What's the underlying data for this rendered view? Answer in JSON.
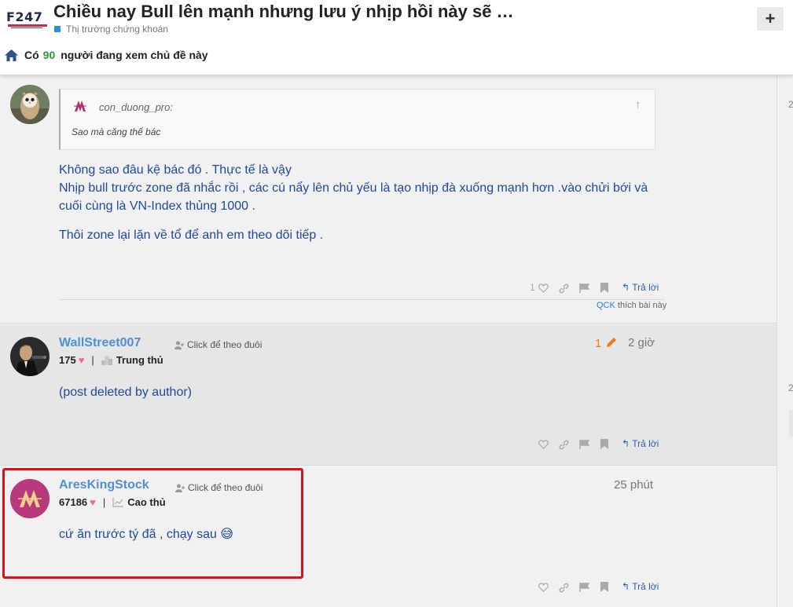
{
  "header": {
    "logo_text": "F247",
    "title": "Chiều nay Bull lên mạnh nhưng lưu ý nhịp hồi này sẽ …",
    "category": "Thị trường chứng khoán",
    "add_label": "+",
    "viewers": {
      "prefix": "Có",
      "count": "90",
      "suffix": "người đang xem chủ đề này"
    }
  },
  "rail": {
    "mark1": "2",
    "mark2": "2"
  },
  "posts": [
    {
      "quote": {
        "author": "con_duong_pro:",
        "text": "Sao mà căng thế bác"
      },
      "lines": [
        "Không sao đâu kệ bác đó . Thực tế là vậy",
        "Nhịp bull trước zone đã nhắc rồi , các cú nẩy lên chủ yếu là tạo nhịp đà xuống mạnh hơn .vào chửi bới và",
        "cuối cùng là VN-Index thủng 1000 .",
        "Thôi zone lại lặn về tổ để anh em theo dõi tiếp ."
      ],
      "like_count": "1",
      "reply_label": "Trả lời",
      "liked_by": {
        "user": "QCK",
        "text": "thích bài này"
      }
    },
    {
      "username": "WallStreet007",
      "follow_label": "Click để theo đuôi",
      "score": "175",
      "rank": "Trung thủ",
      "edits": "1",
      "time": "2 giờ",
      "text": "(post deleted by author)",
      "reply_label": "Trả lời"
    },
    {
      "username": "AresKingStock",
      "follow_label": "Click để theo đuôi",
      "score": "67186",
      "rank": "Cao thủ",
      "time": "25 phút",
      "text": "cứ ăn trước tý đã , chạy sau 😅",
      "reply_label": "Trả lời"
    }
  ],
  "colors": {
    "accent": "#22479e",
    "username": "#4f8fd6",
    "highlight": "#e0101a",
    "viewer_count": "#2a9c3a"
  }
}
